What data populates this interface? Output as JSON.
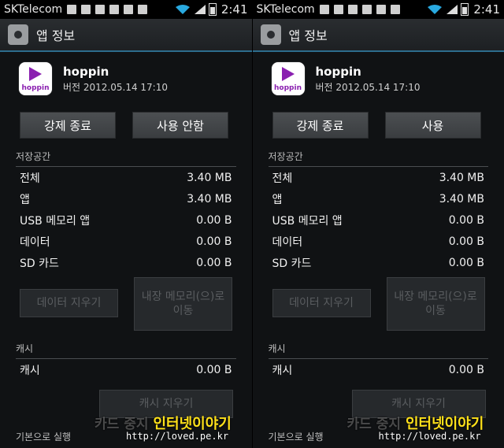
{
  "status_bar": {
    "carrier": "SKTelecom",
    "time": "2:41"
  },
  "title_bar": {
    "title": "앱 정보"
  },
  "app": {
    "name": "hoppin",
    "version": "버전 2012.05.14 17:10",
    "icon_wordmark": "hoppin"
  },
  "buttons": {
    "force_stop": "강제 종료",
    "left_second": "사용 안함",
    "right_second": "사용"
  },
  "storage": {
    "header": "저장공간",
    "rows": [
      {
        "label": "전체",
        "value": "3.40 MB"
      },
      {
        "label": "앱",
        "value": "3.40 MB"
      },
      {
        "label": "USB 메모리 앱",
        "value": "0.00 B"
      },
      {
        "label": "데이터",
        "value": "0.00 B"
      },
      {
        "label": "SD 카드",
        "value": "0.00 B"
      }
    ],
    "clear_data": "데이터 지우기",
    "move_to_internal": "내장 메모리(으)로 이동"
  },
  "cache": {
    "header": "캐시",
    "label": "캐시",
    "value": "0.00 B",
    "clear_cache": "캐시 지우기"
  },
  "launch_default": {
    "header": "기본으로 실행"
  },
  "watermark": {
    "title": "인터넷이야기",
    "ghost": "카드 중지",
    "url": "http://loved.pe.kr"
  },
  "colors": {
    "accent": "#2d6d8d",
    "watermark": "#ffe11a",
    "app_purple": "#8a1fb0"
  }
}
